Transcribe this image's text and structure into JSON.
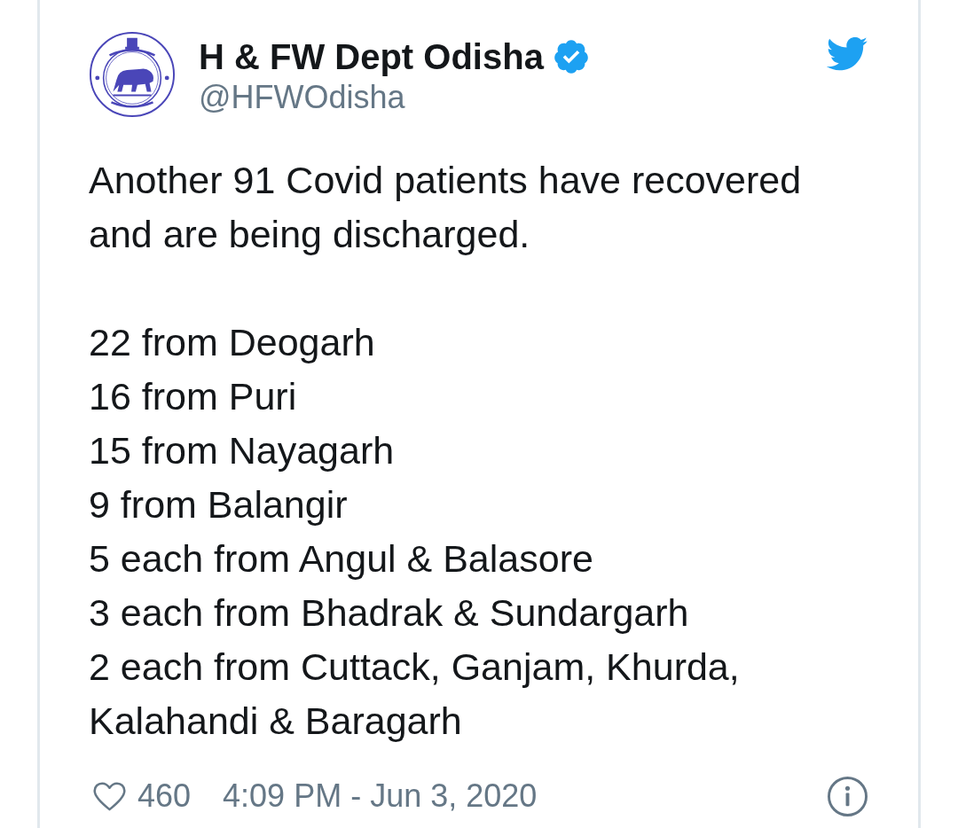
{
  "author": {
    "name": "H & FW Dept Odisha",
    "handle": "@HFWOdisha",
    "verified": true
  },
  "tweet": {
    "text": "Another 91 Covid patients have recovered and are being discharged.",
    "lines": [
      "22 from Deogarh",
      "16 from Puri",
      "15 from Nayagarh",
      "9 from Balangir",
      "5 each from Angul & Balasore",
      "3 each from Bhadrak & Sundargarh",
      "2 each from Cuttack, Ganjam, Khurda, Kalahandi & Baragarh"
    ]
  },
  "footer": {
    "liked": false,
    "likes": "460",
    "timestamp": "4:09 PM - Jun 3, 2020"
  }
}
